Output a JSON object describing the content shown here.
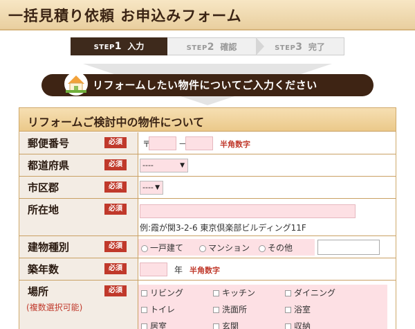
{
  "header": {
    "title": "一括見積り依頼 お申込みフォーム"
  },
  "steps": [
    {
      "prefix": "STEP",
      "num": "1",
      "label": "入力"
    },
    {
      "prefix": "STEP",
      "num": "2",
      "label": "確認"
    },
    {
      "prefix": "STEP",
      "num": "3",
      "label": "完了"
    }
  ],
  "banner": {
    "text": "リフォームしたい物件についてご入力ください",
    "icon": "house-icon"
  },
  "section": {
    "title": "リフォームご検討中の物件について"
  },
  "required_label": "必須",
  "rows": {
    "postal": {
      "label": "郵便番号",
      "prefix": "〒",
      "dash": "－",
      "note": "半角数字",
      "value1": "",
      "value2": ""
    },
    "prefecture": {
      "label": "都道府県",
      "selected": "----"
    },
    "city": {
      "label": "市区郡",
      "selected": "----"
    },
    "address": {
      "label": "所在地",
      "value": "",
      "example": "例:霞が関3-2-6 東京倶楽部ビルディング11F"
    },
    "building": {
      "label": "建物種別",
      "options": [
        "一戸建て",
        "マンション",
        "その他"
      ],
      "other_value": ""
    },
    "age": {
      "label": "築年数",
      "unit": "年",
      "note": "半角数字",
      "value": ""
    },
    "place": {
      "label": "場所",
      "sublabel": "(複数選択可能)",
      "options": [
        "リビング",
        "キッチン",
        "ダイニング",
        "トイレ",
        "洗面所",
        "浴室",
        "居室",
        "玄関",
        "収納"
      ]
    }
  },
  "colors": {
    "accent": "#3e2414",
    "required": "#c0392b",
    "field_bg": "#fde0e4"
  }
}
